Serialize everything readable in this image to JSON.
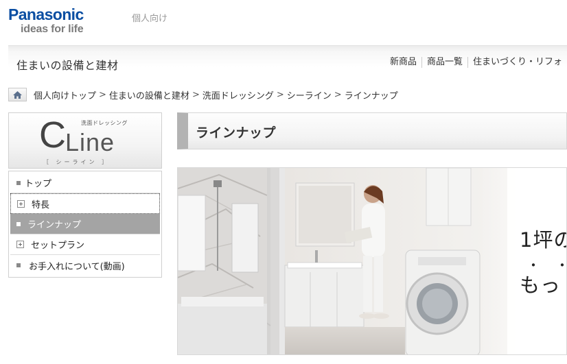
{
  "header": {
    "brand": "Panasonic",
    "tagline": "ideas for life",
    "audience": "個人向け"
  },
  "category": {
    "title": "住まいの設備と建材",
    "nav": [
      "新商品",
      "商品一覧",
      "住まいづくり・リフォ"
    ]
  },
  "breadcrumb": [
    "個人向けトップ",
    "住まいの設備と建材",
    "洗面ドレッシング",
    "シーライン",
    "ラインナップ"
  ],
  "sidebar": {
    "logo": {
      "small": "洗面ドレッシング",
      "c": "C",
      "line": "Line",
      "kana": "［ シーライン ］"
    },
    "menu": [
      {
        "label": "トップ",
        "marker": "square"
      },
      {
        "label": "特長",
        "marker": "plus"
      },
      {
        "label": "ラインナップ",
        "marker": "square",
        "active": true
      },
      {
        "label": "セットプラン",
        "marker": "plus"
      },
      {
        "label": "お手入れについて(動画)",
        "marker": "square"
      }
    ]
  },
  "main": {
    "heading": "ラインナップ",
    "hero": {
      "copy_line1": "1坪の",
      "copy_dots": "・・",
      "copy_line2": "もっ"
    }
  },
  "colors": {
    "brand_blue": "#0b4ea2",
    "active_menu": "#a4a4a4"
  },
  "icons": {
    "home": "home-icon"
  }
}
